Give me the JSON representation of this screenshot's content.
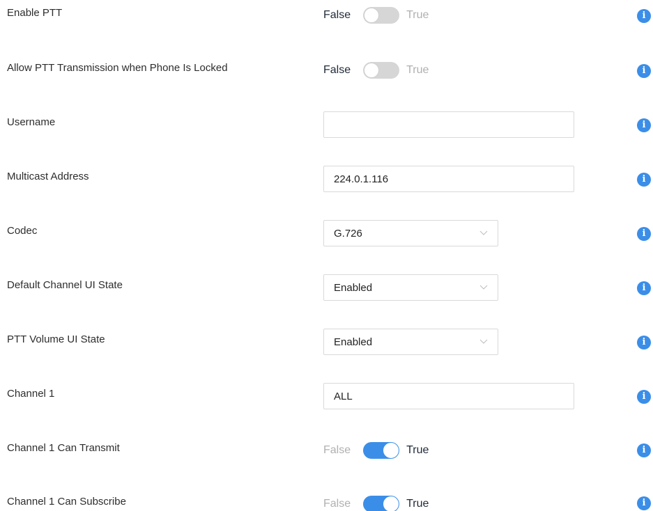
{
  "settings": {
    "enable_ptt": {
      "label": "Enable PTT",
      "false_label": "False",
      "true_label": "True",
      "value": false
    },
    "allow_ptt_locked": {
      "label": "Allow PTT Transmission when Phone Is Locked",
      "false_label": "False",
      "true_label": "True",
      "value": false
    },
    "username": {
      "label": "Username",
      "value": "",
      "placeholder": ""
    },
    "multicast_address": {
      "label": "Multicast Address",
      "value": "224.0.1.116"
    },
    "codec": {
      "label": "Codec",
      "selected": "G.726"
    },
    "default_channel_ui_state": {
      "label": "Default Channel UI State",
      "selected": "Enabled"
    },
    "ptt_volume_ui_state": {
      "label": "PTT Volume UI State",
      "selected": "Enabled"
    },
    "channel_1": {
      "label": "Channel 1",
      "value": "ALL"
    },
    "channel_1_can_transmit": {
      "label": "Channel 1 Can Transmit",
      "false_label": "False",
      "true_label": "True",
      "value": true
    },
    "channel_1_can_subscribe": {
      "label": "Channel 1 Can Subscribe",
      "false_label": "False",
      "true_label": "True",
      "value": true
    }
  },
  "icons": {
    "info": "info-icon",
    "chevron": "chevron-down-icon"
  },
  "info_glyph": "i",
  "colors": {
    "accent": "#3b8ee8",
    "toggle_off": "#d6d6d6",
    "dim_text": "#b0b0b0",
    "border": "#d9d9d9"
  }
}
